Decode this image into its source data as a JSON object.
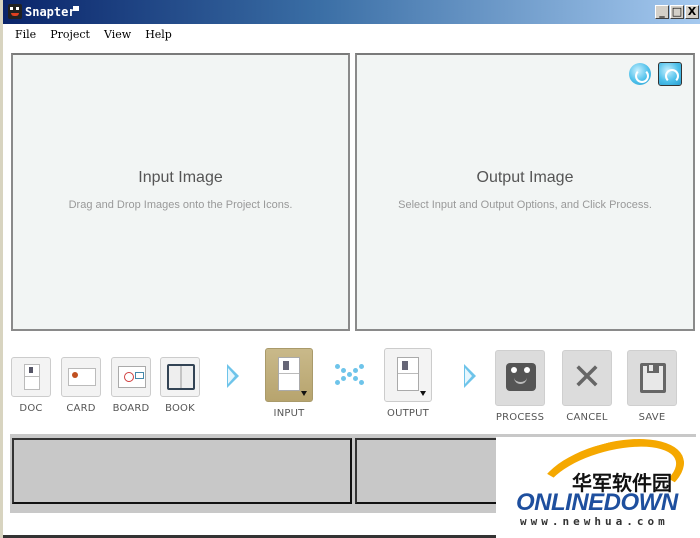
{
  "window": {
    "title": "Snapter",
    "controls": {
      "minimize": "_",
      "maximize": "□",
      "close": "X"
    }
  },
  "menu": [
    "File",
    "Project",
    "View",
    "Help"
  ],
  "input_panel": {
    "title": "Input Image",
    "subtitle": "Drag and Drop Images onto the Project Icons."
  },
  "output_panel": {
    "title": "Output Image",
    "subtitle": "Select Input and Output Options, and Click Process.",
    "buttons": [
      "rotate-icon",
      "flip-icon"
    ]
  },
  "project_types": [
    {
      "label": "DOC",
      "icon": "document-icon"
    },
    {
      "label": "CARD",
      "icon": "business-card-icon"
    },
    {
      "label": "BOARD",
      "icon": "whiteboard-icon"
    },
    {
      "label": "BOOK",
      "icon": "book-icon"
    }
  ],
  "io": {
    "input_label": "INPUT",
    "output_label": "OUTPUT"
  },
  "actions": [
    {
      "label": "PROCESS",
      "icon": "robot-icon"
    },
    {
      "label": "CANCEL",
      "icon": "x-icon"
    },
    {
      "label": "SAVE",
      "icon": "floppy-disk-icon"
    }
  ],
  "watermark": {
    "chinese": "华军软件园",
    "brand": "ONLINEDOWN",
    "url": "www.newhua.com"
  },
  "colors": {
    "title_bar_start": "#0a246a",
    "title_bar_end": "#a6caf0",
    "accent_blue": "#6ec4ea",
    "input_selected": "#c9b98a",
    "panel_bg": "#f2f5f4",
    "strip_bg": "#c8c8c8"
  }
}
